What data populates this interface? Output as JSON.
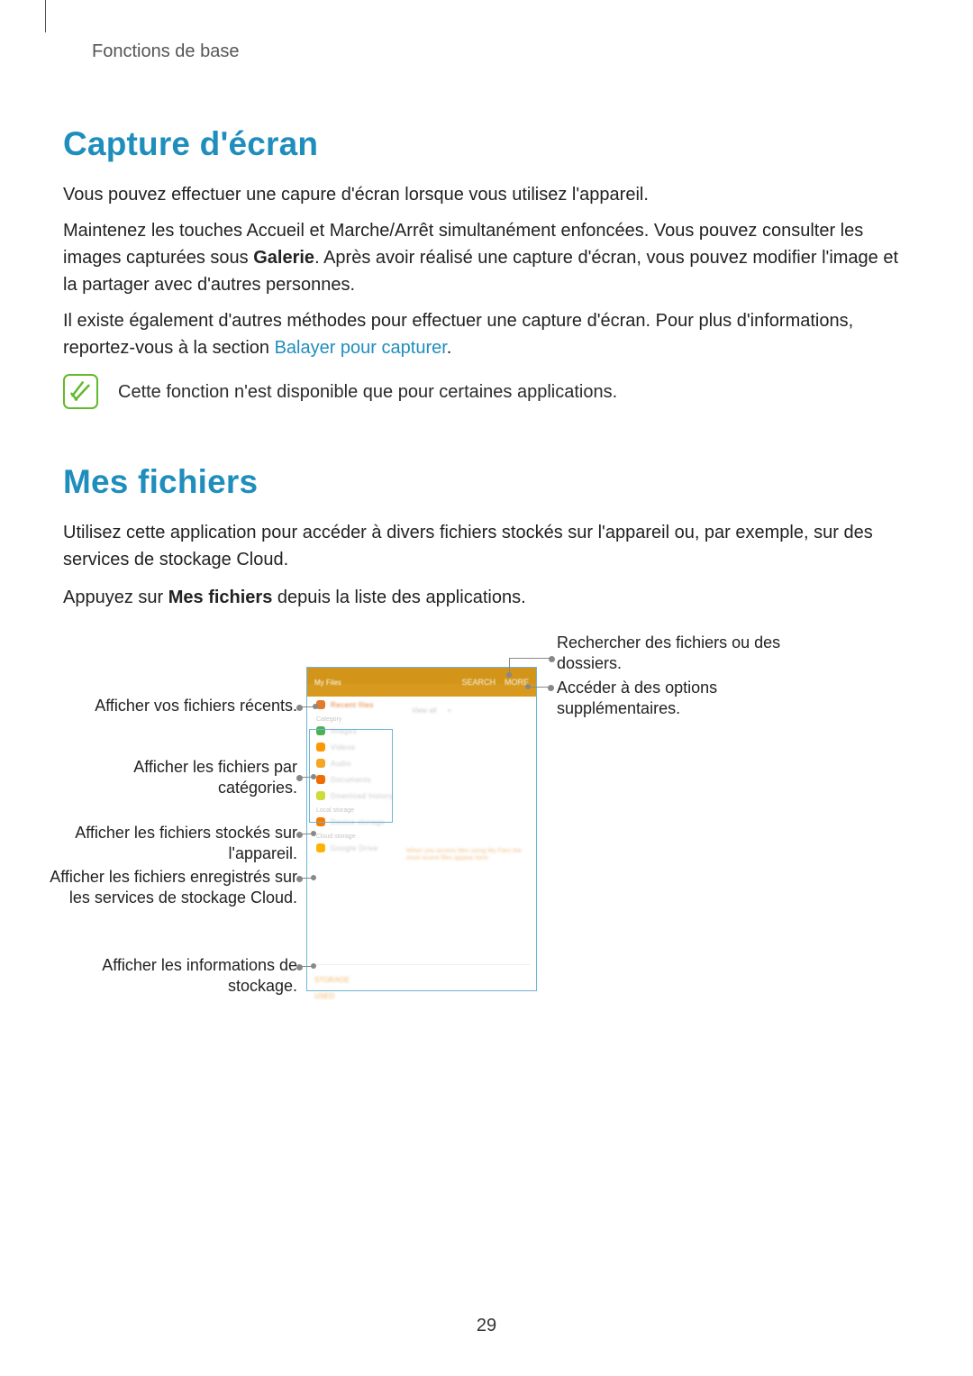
{
  "page": {
    "header": "Fonctions de base",
    "number": "29"
  },
  "section1": {
    "title": "Capture d'écran",
    "p1": "Vous pouvez effectuer une capure d'écran lorsque vous utilisez l'appareil.",
    "p2a": "Maintenez les touches Accueil et Marche/Arrêt simultanément enfoncées. Vous pouvez consulter les images capturées sous ",
    "p2bold": "Galerie",
    "p2b": ". Après avoir réalisé une capture d'écran, vous pouvez modifier l'image et la partager avec d'autres personnes.",
    "p3a": "Il existe également d'autres méthodes pour effectuer une capture d'écran. Pour plus d'informations, reportez-vous à la section ",
    "p3link": "Balayer pour capturer",
    "p3b": ".",
    "note": "Cette fonction n'est disponible que pour certaines applications."
  },
  "section2": {
    "title": "Mes fichiers",
    "p1": "Utilisez cette application pour accéder à divers fichiers stockés sur l'appareil ou, par exemple, sur des services de stockage Cloud.",
    "p2a": "Appuyez sur ",
    "p2bold": "Mes fichiers",
    "p2b": " depuis la liste des applications."
  },
  "callouts": {
    "recent": "Afficher vos fichiers récents.",
    "categories": "Afficher les fichiers par catégories.",
    "device": "Afficher les fichiers stockés sur l'appareil.",
    "cloud": "Afficher les fichiers enregistrés sur les services de stockage Cloud.",
    "storage": "Afficher les informations de stockage.",
    "search": "Rechercher des fichiers ou des dossiers.",
    "more": "Accéder à des options supplémentaires."
  },
  "screen": {
    "title": "My Files",
    "search": "SEARCH",
    "more": "MORE",
    "recent": "Recent files",
    "viewall": "View all",
    "plus": "+",
    "cat_label": "Category",
    "images": "Images",
    "videos": "Videos",
    "audio": "Audio",
    "documents": "Documents",
    "downloads": "Download history",
    "local_label": "Local storage",
    "device": "Device storage",
    "cloud_label": "Cloud storage",
    "drive": "Google Drive",
    "detail": "When you access files using My Files the most recent files appear here.",
    "storage_used": "STORAGE USED"
  }
}
